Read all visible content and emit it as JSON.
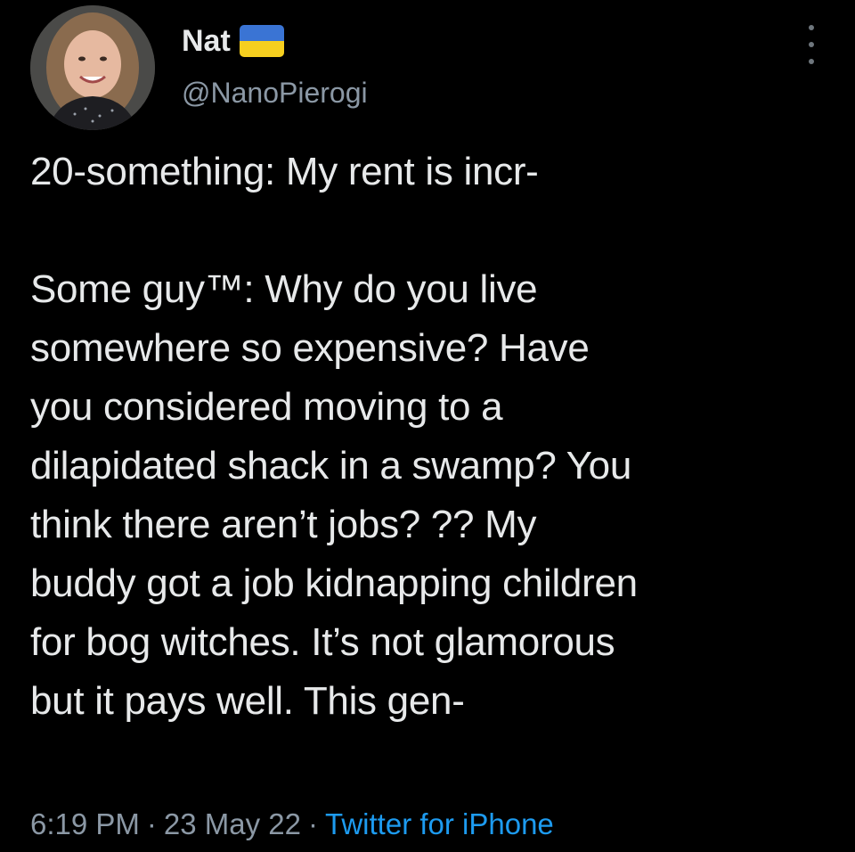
{
  "user": {
    "display_name": "Nat",
    "handle": "@NanoPierogi",
    "flag": {
      "icon": "ukraine-flag-icon",
      "top_color": "#3a74d4",
      "bottom_color": "#f6cf1f"
    }
  },
  "menu": {
    "icon": "more-options-icon"
  },
  "tweet": {
    "lines": [
      "20-something: My rent is incr-",
      "",
      "Some guy™: Why do you live",
      "somewhere so expensive? Have",
      "you considered moving to a",
      "dilapidated shack in a swamp? You",
      "think there aren’t jobs? ?? My",
      "buddy got a job kidnapping children",
      "for bog witches. It’s not glamorous",
      "but it pays well. This gen-"
    ]
  },
  "meta": {
    "time": "6:19 PM",
    "separator": "·",
    "date": "23 May 22",
    "source": "Twitter for iPhone"
  },
  "colors": {
    "background": "#000000",
    "text": "#e7e9ea",
    "muted": "#8b98a5",
    "link": "#1d9bf0"
  }
}
